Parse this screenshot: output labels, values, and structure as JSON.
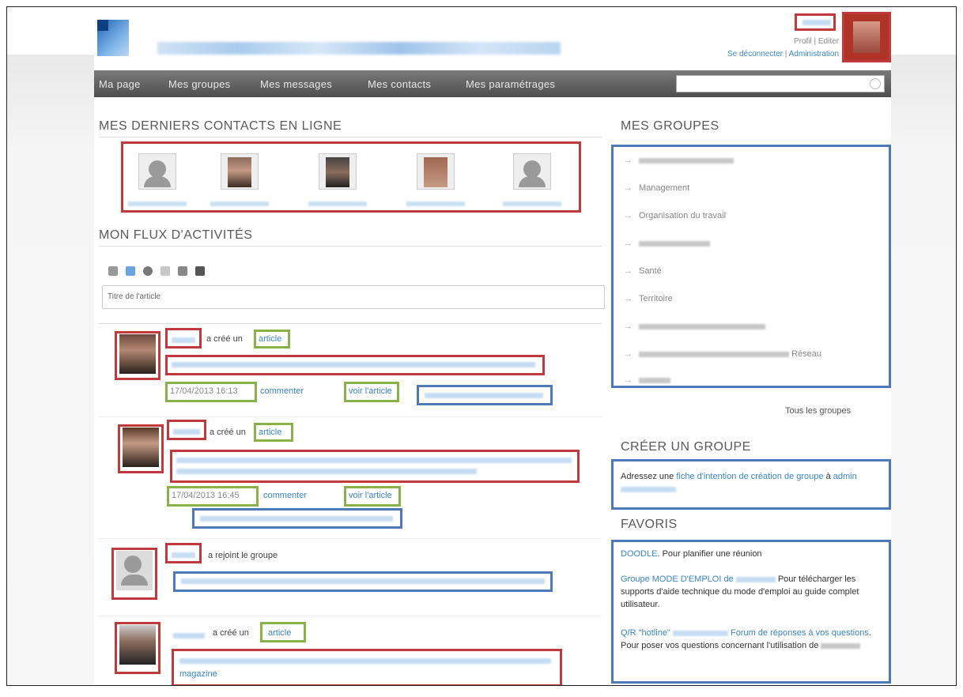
{
  "header": {
    "user_links_line1": "Profil | Editer",
    "logout_link": "Se déconnecter",
    "separator": "|",
    "admin_link": "Administration"
  },
  "nav": {
    "items": [
      {
        "label": "Ma page"
      },
      {
        "label": "Mes groupes"
      },
      {
        "label": "Mes messages"
      },
      {
        "label": "Mes contacts"
      },
      {
        "label": "Mes paramétrages"
      }
    ]
  },
  "contacts": {
    "title": "MES DERNIERS CONTACTS EN LIGNE"
  },
  "activity": {
    "title": "MON FLUX D'ACTIVITÉS",
    "input_placeholder": "Titre de l'article",
    "items": [
      {
        "verb": "a créé un",
        "object": "article",
        "date": "17/04/2013 16:13",
        "comment": "commenter",
        "view": "voir l'article"
      },
      {
        "verb": "a créé un",
        "object": "article",
        "date": "17/04/2013 16:45",
        "comment": "commenter",
        "view": "voir l'article"
      },
      {
        "verb": "a rejoint le groupe"
      },
      {
        "verb": "a créé un",
        "object": "article",
        "tail": "magazine"
      }
    ]
  },
  "groups": {
    "title": "MES GROUPES",
    "all_link": "Tous les groupes",
    "items": [
      "Management",
      "Organisation du travail",
      "Santé",
      "Territoire",
      "Réseau"
    ]
  },
  "create_group": {
    "title": "CRÉER UN GROUPE",
    "text_before": "Adressez une",
    "link": "fiche d'intention de création de groupe",
    "text_after": "à",
    "email": "admin"
  },
  "favoris": {
    "title": "FAVORIS",
    "f1_link": "DOODLE",
    "f1_text": ". Pour planifier une réunion",
    "f2_link": "Groupe MODE D'EMPLOI de",
    "f2_text": "Pour télécharger les supports d'aide technique du mode d'emploi au guide complet utilisateur.",
    "f3_link": "Q/R \"hotline\"",
    "f3_link2": "Forum de réponses à vos questions",
    "f3_text": ". Pour poser vos questions concernant l'utilisation de"
  }
}
